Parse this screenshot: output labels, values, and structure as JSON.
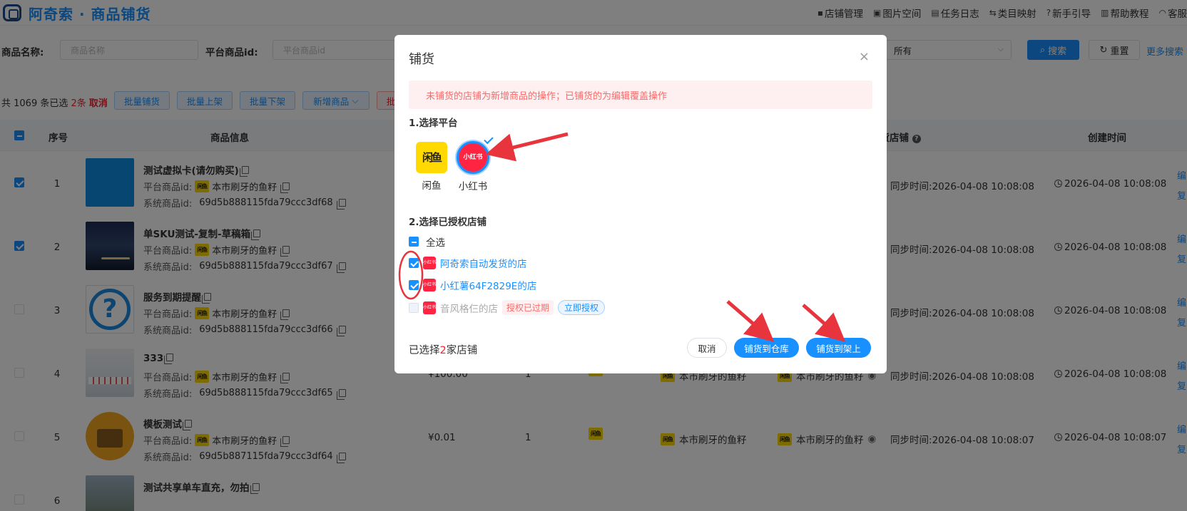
{
  "header": {
    "title": "阿奇索 · 商品铺货",
    "nav": [
      {
        "name": "nav-store-management",
        "icon": "store-icon",
        "glyph": "▪",
        "label": "店铺管理"
      },
      {
        "name": "nav-image-space",
        "icon": "image-icon",
        "glyph": "▣",
        "label": "图片空间"
      },
      {
        "name": "nav-task-log",
        "icon": "log-icon",
        "glyph": "▤",
        "label": "任务日志"
      },
      {
        "name": "nav-category-mapping",
        "icon": "mapping-icon",
        "glyph": "⇆",
        "label": "类目映射"
      },
      {
        "name": "nav-beginner-guide",
        "icon": "question-icon",
        "glyph": "?",
        "label": "新手引导"
      },
      {
        "name": "nav-help-tutorial",
        "icon": "book-icon",
        "glyph": "▥",
        "label": "帮助教程"
      },
      {
        "name": "nav-customer-service",
        "icon": "headset-icon",
        "glyph": "◠",
        "label": "客服"
      }
    ]
  },
  "filter": {
    "name_label": "商品名称:",
    "name_placeholder": "商品名称",
    "platform_id_label": "平台商品id:",
    "platform_id_placeholder": "平台商品id",
    "select_value": "所有",
    "search_label": "搜索",
    "reset_label": "重置",
    "more_search_label": "更多搜索"
  },
  "toolbar": {
    "count_prefix": "共 1069 条已选",
    "selected_count": "2条",
    "cancel": "取消",
    "batch_distribute": "批量铺货",
    "batch_list": "批量上架",
    "batch_delist": "批量下架",
    "add_product": "新增商品",
    "danger_partial": "批"
  },
  "table": {
    "headers": {
      "seq": "序号",
      "info": "商品信息",
      "shop": "铺货店铺",
      "created": "创建时间"
    },
    "platform_id_label": "平台商品id:",
    "system_id_label": "系统商品id:",
    "sync_label": "同步时间:",
    "op_edit": "编",
    "op_copy": "复",
    "xianyu_badge": "闲鱼",
    "rows": [
      {
        "seq": "1",
        "checked": true,
        "name": "测试虚拟卡(请勿购买)",
        "shop": "本市刷牙的鱼籽",
        "system_id": "69d5b888115fda79ccc3df68",
        "sync": "2026-04-08 10:08:08",
        "created": "2026-04-08 10:08:08",
        "thumb": "blue"
      },
      {
        "seq": "2",
        "checked": true,
        "name": "单SKU测试-复制-草稿箱",
        "shop": "本市刷牙的鱼籽",
        "system_id": "69d5b888115fda79ccc3df67",
        "sync": "2026-04-08 10:08:08",
        "created": "2026-04-08 10:08:08",
        "thumb": "night"
      },
      {
        "seq": "3",
        "checked": false,
        "name": "服务到期提醒",
        "shop": "本市刷牙的鱼籽",
        "system_id": "69d5b888115fda79ccc3df66",
        "sync": "2026-04-08 10:08:08",
        "created": "2026-04-08 10:08:08",
        "thumb": "question"
      },
      {
        "seq": "4",
        "checked": false,
        "name": "333",
        "shop": "本市刷牙的鱼籽",
        "system_id": "69d5b888115fda79ccc3df65",
        "price": "¥100.00",
        "stock": "1",
        "shop2": "本市刷牙的鱼籽",
        "shop3": "本市刷牙的鱼籽",
        "sync": "2026-04-08 10:08:08",
        "created": "2026-04-08 10:08:08",
        "thumb": "shelf"
      },
      {
        "seq": "5",
        "checked": false,
        "name": "模板测试",
        "shop": "本市刷牙的鱼籽",
        "system_id": "69d5b887115fda79ccc3df64",
        "price": "¥0.01",
        "stock": "1",
        "shop2": "本市刷牙的鱼籽",
        "shop3": "本市刷牙的鱼籽",
        "sync": "2026-04-08 10:08:07",
        "created": "2026-04-08 10:08:07",
        "thumb": "wallet"
      },
      {
        "seq": "6",
        "checked": false,
        "name": "测试共享单车直充，勿拍",
        "thumb": "road"
      }
    ]
  },
  "modal": {
    "title": "铺货",
    "close": "×",
    "alert": "未铺货的店铺为新增商品的操作；已铺货的为编辑覆盖操作",
    "step1": "1.选择平台",
    "platforms": [
      {
        "name": "闲鱼",
        "logo": "闲鱼"
      },
      {
        "name": "小红书",
        "logo": "小红书"
      }
    ],
    "step2": "2.选择已授权店铺",
    "select_all": "全选",
    "shops": [
      {
        "name": "阿奇索自动发货的店",
        "checked": true
      },
      {
        "name": "小红薯64F2829E的店",
        "checked": true
      },
      {
        "name": "音风格仨的店",
        "checked": false,
        "expired_tag": "授权已过期",
        "auth_button": "立即授权"
      }
    ],
    "xhs_mini": "小红书",
    "footer_prefix": "已选择",
    "footer_count": "2",
    "footer_suffix": "家店铺",
    "cancel": "取消",
    "to_warehouse": "铺货到仓库",
    "to_shelf": "铺货到架上"
  },
  "colors": {
    "primary": "#1890ff",
    "danger": "#f5222d",
    "xianyu_yellow": "#ffd900",
    "xiaohongshu_red": "#ff2442",
    "annotation_red": "#e8343c"
  }
}
